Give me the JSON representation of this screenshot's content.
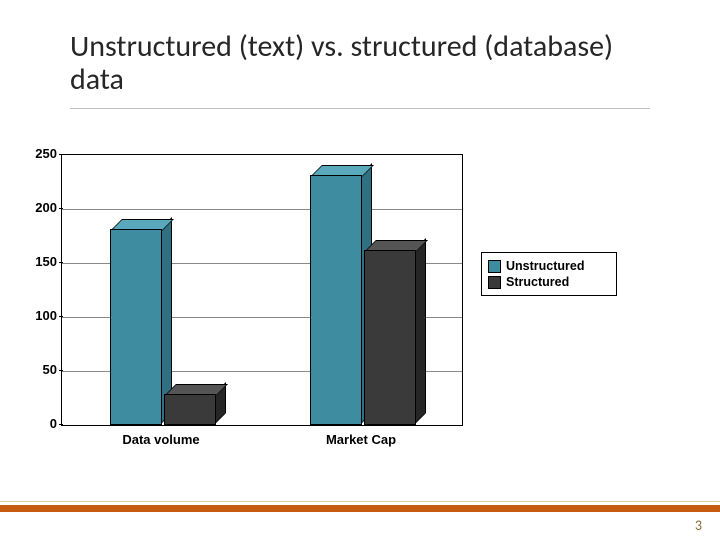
{
  "title": "Unstructured (text) vs. structured (database) data",
  "page_number": "3",
  "legend": {
    "unstructured": "Unstructured",
    "structured": "Structured"
  },
  "colors": {
    "unstructured_front": "#3d8ca0",
    "unstructured_top": "#5aa8bb",
    "unstructured_side": "#2f7082",
    "structured_front": "#3a3a3a",
    "structured_top": "#555555",
    "structured_side": "#262626",
    "accent_bar": "#c55a11"
  },
  "chart_data": {
    "type": "bar",
    "title": "",
    "xlabel": "",
    "ylabel": "",
    "ylim": [
      0,
      250
    ],
    "yticks": [
      0,
      50,
      100,
      150,
      200,
      250
    ],
    "categories": [
      "Data volume",
      "Market Cap"
    ],
    "series": [
      {
        "name": "Unstructured",
        "values": [
          180,
          230
        ]
      },
      {
        "name": "Structured",
        "values": [
          27,
          160
        ]
      }
    ]
  }
}
